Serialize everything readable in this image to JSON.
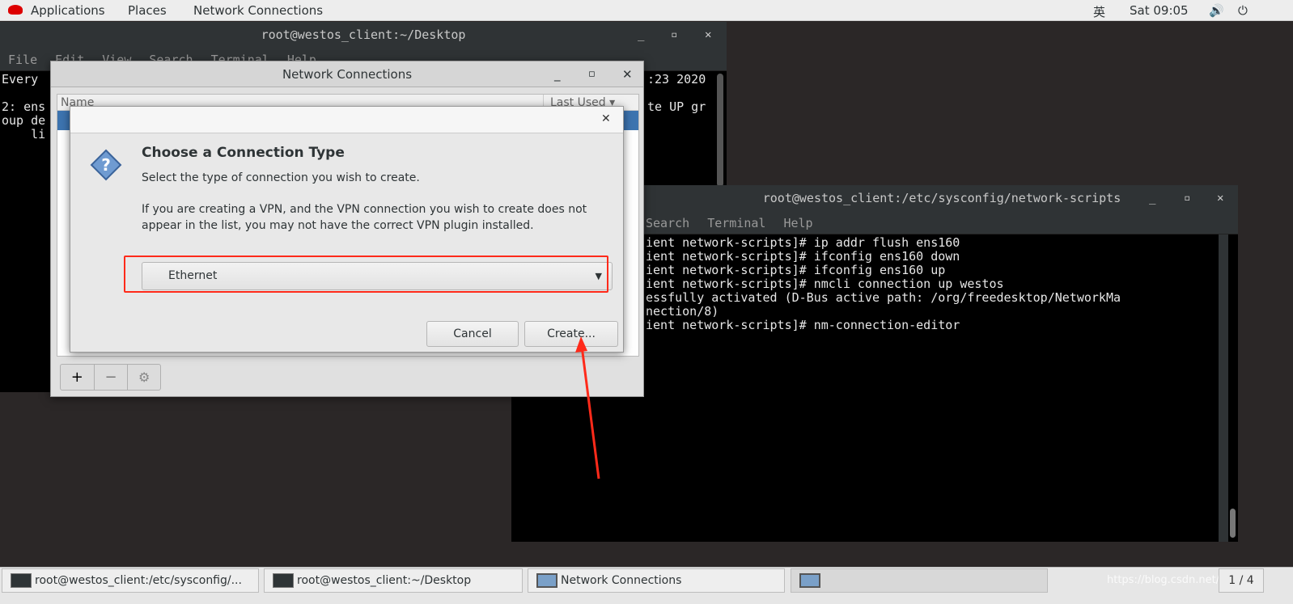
{
  "topbar": {
    "applications": "Applications",
    "places": "Places",
    "app_name": "Network Connections",
    "input_method": "英",
    "clock": "Sat 09:05"
  },
  "term1": {
    "title": "root@westos_client:~/Desktop",
    "menu": [
      "File",
      "Edit",
      "View",
      "Search",
      "Terminal",
      "Help"
    ],
    "lines": [
      "Every",
      ":23 2020",
      "2: ens",
      "te UP gr",
      "oup de",
      "    li"
    ]
  },
  "nc": {
    "title": "Network Connections",
    "col_name": "Name",
    "col_last_used": "Last Used",
    "add": "+",
    "remove": "−"
  },
  "dialog": {
    "heading": "Choose a Connection Type",
    "subtitle": "Select the type of connection you wish to create.",
    "body": "If you are creating a VPN, and the VPN connection you wish to create does not appear in the list, you may not have the correct VPN plugin installed.",
    "selected_type": "Ethernet",
    "cancel": "Cancel",
    "create": "Create..."
  },
  "term2": {
    "title": "root@westos_client:/etc/sysconfig/network-scripts",
    "menu": [
      "Search",
      "Terminal",
      "Help"
    ],
    "lines": [
      "ient network-scripts]# ip addr flush ens160",
      "ient network-scripts]# ifconfig ens160 down",
      "ient network-scripts]# ifconfig ens160 up",
      "ient network-scripts]# nmcli connection up westos",
      "essfully activated (D-Bus active path: /org/freedesktop/NetworkMa",
      "nection/8)",
      "ient network-scripts]# nm-connection-editor"
    ]
  },
  "taskbar": {
    "items": [
      "root@westos_client:/etc/sysconfig/...",
      "root@westos_client:~/Desktop",
      "Network Connections",
      ""
    ],
    "workspace": "1 / 4",
    "watermark": "https://blog.csdn.net/St..."
  },
  "colors": {
    "annotation": "#ff2a1a",
    "selection": "#3d74b0"
  }
}
